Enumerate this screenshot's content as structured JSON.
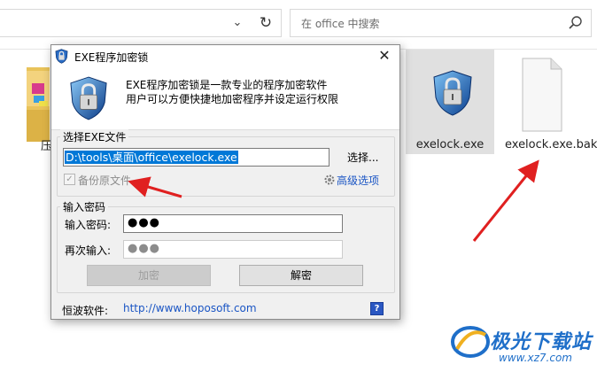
{
  "explorer": {
    "search_placeholder": "在 office 中搜索",
    "chevron_glyph": "⌄",
    "refresh_glyph": "↻",
    "folder_label": "压",
    "files": [
      {
        "name": "exelock.exe",
        "selected": true
      },
      {
        "name": "exelock.exe.bak",
        "selected": false
      }
    ]
  },
  "dialog": {
    "title": "EXE程序加密锁",
    "close_glyph": "✕",
    "header_line1": "EXE程序加密锁是一款专业的程序加密软件",
    "header_line2": "用户可以方便快捷地加密程序并设定运行权限",
    "select_group_title": "选择EXE文件",
    "path_value": "D:\\tools\\桌面\\office\\exelock.exe",
    "browse_label": "选择...",
    "backup_label": "备份原文件",
    "backup_checked": true,
    "backup_check_glyph": "✓",
    "advanced_label": "高级选项",
    "password_group_title": "输入密码",
    "password_label": "输入密码:",
    "password_value": "●●●",
    "confirm_label": "再次输入:",
    "confirm_value": "●●●",
    "encrypt_button": "加密",
    "decrypt_button": "解密",
    "footer_label": "恒波软件:",
    "footer_link": "http://www.hoposoft.com",
    "help_glyph": "?"
  },
  "watermark": {
    "name": "极光下载站",
    "url": "www.xz7.com"
  },
  "colors": {
    "accent_blue": "#0078d7",
    "link_blue": "#1a55c4",
    "arrow_red": "#e02020"
  }
}
